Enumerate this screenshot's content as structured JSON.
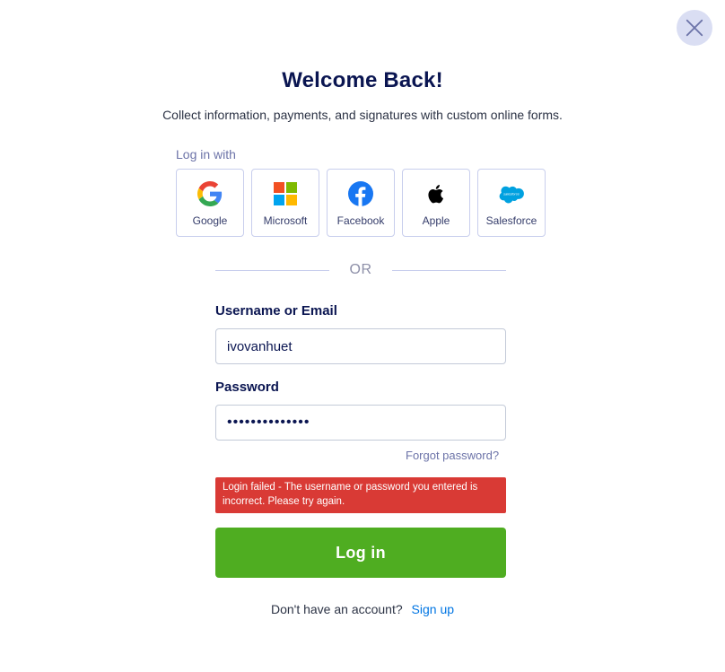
{
  "header": {
    "title": "Welcome Back!",
    "subtitle": "Collect information, payments, and signatures with custom online forms."
  },
  "social": {
    "heading": "Log in with",
    "providers": [
      {
        "label": "Google",
        "icon": "google-icon"
      },
      {
        "label": "Microsoft",
        "icon": "microsoft-icon"
      },
      {
        "label": "Facebook",
        "icon": "facebook-icon"
      },
      {
        "label": "Apple",
        "icon": "apple-icon"
      },
      {
        "label": "Salesforce",
        "icon": "salesforce-icon"
      }
    ],
    "salesforce_logo_text": "salesforce"
  },
  "divider": {
    "label": "OR"
  },
  "form": {
    "username_label": "Username or Email",
    "username_value": "ivovanhuet",
    "password_label": "Password",
    "password_value": "••••••••••••••",
    "forgot_label": "Forgot password?",
    "error_message": "Login failed - The username or password you entered is incorrect. Please try again.",
    "submit_label": "Log in"
  },
  "footer": {
    "prompt": "Don't have an account?",
    "signup_label": "Sign up"
  },
  "colors": {
    "primary_button": "#4fad21",
    "error_bg": "#d93a35",
    "link": "#0075e3",
    "heading": "#0a1551"
  }
}
